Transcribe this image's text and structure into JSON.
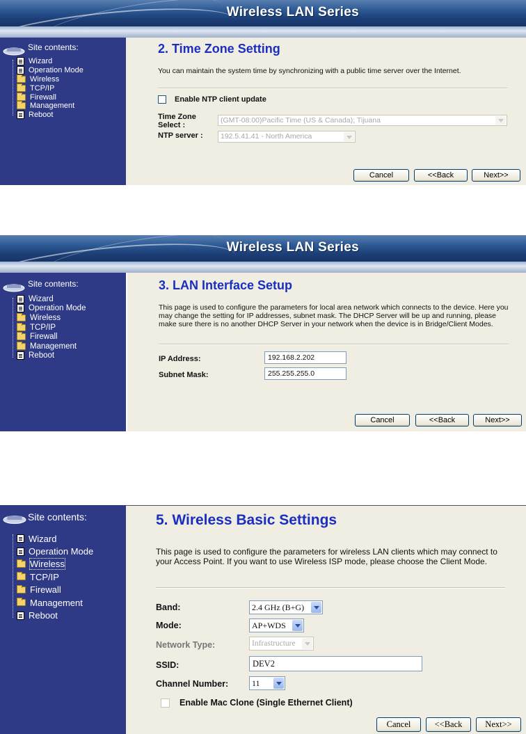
{
  "sidebar": {
    "title": "Site contents:",
    "items": [
      {
        "label": "Wizard",
        "icon": "page-icon"
      },
      {
        "label": "Operation Mode",
        "icon": "page-icon"
      },
      {
        "label": "Wireless",
        "icon": "folder-icon"
      },
      {
        "label": "TCP/IP",
        "icon": "folder-icon"
      },
      {
        "label": "Firewall",
        "icon": "folder-icon"
      },
      {
        "label": "Management",
        "icon": "folder-icon"
      },
      {
        "label": "Reboot",
        "icon": "page-icon"
      }
    ]
  },
  "buttons": {
    "cancel": "Cancel",
    "back": "<<Back",
    "next": "Next>>"
  },
  "screen1": {
    "banner": "Wireless LAN Series",
    "title": "2. Time Zone Setting",
    "description": "You can maintain the system time by synchronizing with a public time server over the Internet.",
    "ntp_checkbox_label": "Enable NTP client update",
    "timezone_label": "Time Zone Select :",
    "timezone_value": "(GMT-08:00)Pacific Time (US & Canada); Tijuana",
    "ntp_server_label": "NTP server :",
    "ntp_server_value": "192.5.41.41 - North America"
  },
  "screen2": {
    "banner": "Wireless LAN Series",
    "title": "3. LAN Interface Setup",
    "description": "This page is used to configure the parameters for local area network which connects to the device. Here you may change the setting for IP addresses, subnet mask. The DHCP Server will be up and running, please make sure there is no another DHCP Server in your network when the device is in Bridge/Client Modes.",
    "ip_label": "IP Address:",
    "ip_value": "192.168.2.202",
    "mask_label": "Subnet Mask:",
    "mask_value": "255.255.255.0"
  },
  "screen3": {
    "title": "5. Wireless Basic Settings",
    "description": "This page is used to configure the parameters for wireless LAN clients which may connect to your Access Point. If you want to use Wireless ISP mode, please choose the Client Mode.",
    "band_label": "Band:",
    "band_value": "2.4 GHz (B+G)",
    "mode_label": "Mode:",
    "mode_value": "AP+WDS",
    "network_type_label": "Network Type:",
    "network_type_value": "Infrastructure",
    "ssid_label": "SSID:",
    "ssid_value": "DEV2",
    "channel_label": "Channel Number:",
    "channel_value": "11",
    "mac_clone_label": "Enable Mac Clone (Single Ethernet Client)"
  }
}
